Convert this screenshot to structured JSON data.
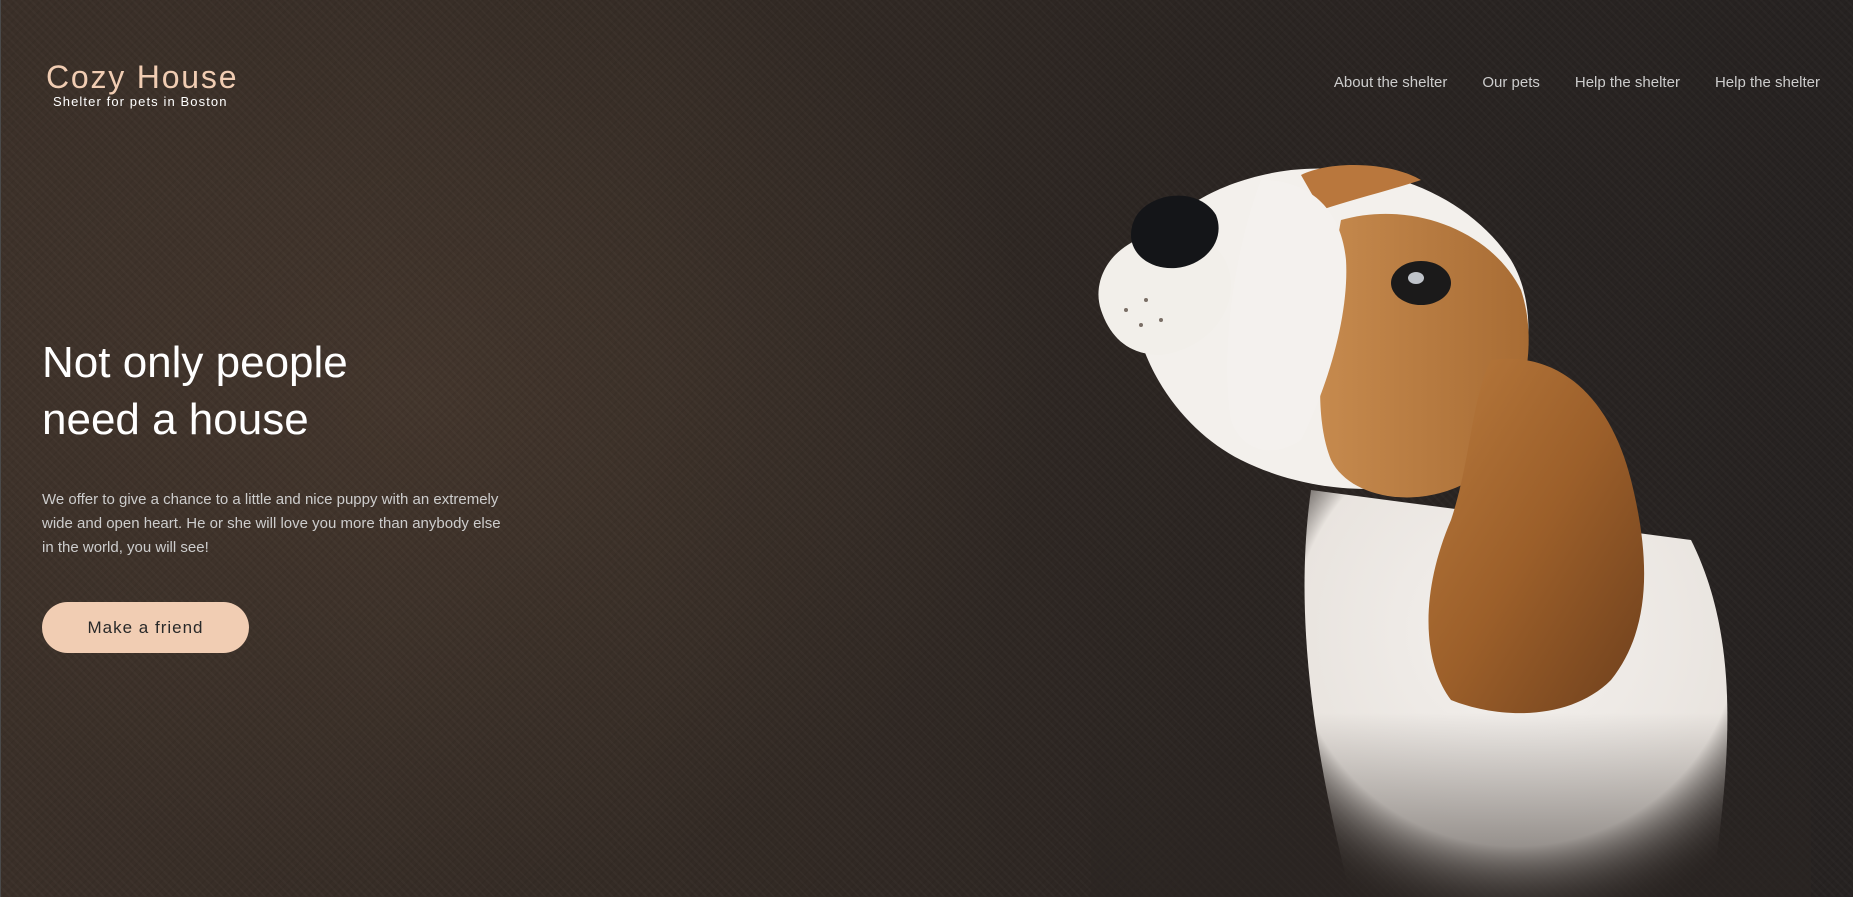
{
  "logo": {
    "title": "Cozy House",
    "subtitle": "Shelter for pets in Boston"
  },
  "nav": {
    "items": [
      {
        "label": "About the shelter"
      },
      {
        "label": "Our pets"
      },
      {
        "label": "Help the shelter"
      },
      {
        "label": "Help the shelter"
      }
    ]
  },
  "hero": {
    "headline_line1": "Not only people",
    "headline_line2": "need a house",
    "description": "We offer to give a chance to a little and nice puppy with an extremely wide and open heart. He or she will love you more than anybody else in the world, you will see!",
    "cta_label": "Make a friend",
    "image": "beagle-puppy-photo"
  },
  "colors": {
    "accent": "#f1cdb3",
    "background_dark": "#2f2824",
    "nav_text": "#cdcdcd",
    "headline_text": "#ffffff"
  }
}
